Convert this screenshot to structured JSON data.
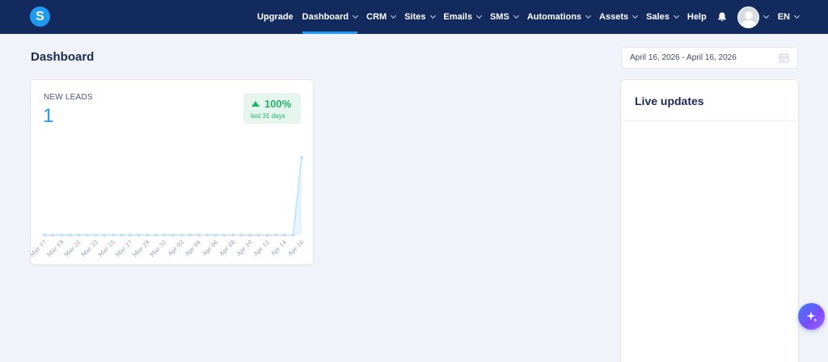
{
  "brand": {
    "logo_letter": "S"
  },
  "nav": {
    "items": [
      {
        "label": "Upgrade",
        "dropdown": false,
        "active": false
      },
      {
        "label": "Dashboard",
        "dropdown": true,
        "active": true
      },
      {
        "label": "CRM",
        "dropdown": true,
        "active": false
      },
      {
        "label": "Sites",
        "dropdown": true,
        "active": false
      },
      {
        "label": "Emails",
        "dropdown": true,
        "active": false
      },
      {
        "label": "SMS",
        "dropdown": true,
        "active": false
      },
      {
        "label": "Automations",
        "dropdown": true,
        "active": false
      },
      {
        "label": "Assets",
        "dropdown": true,
        "active": false
      },
      {
        "label": "Sales",
        "dropdown": true,
        "active": false
      },
      {
        "label": "Help",
        "dropdown": false,
        "active": false
      }
    ],
    "language": "EN"
  },
  "page": {
    "title": "Dashboard"
  },
  "date_range": {
    "value": "April 16, 2026 - April 16, 2026"
  },
  "leads": {
    "label": "NEW LEADS",
    "value": "1",
    "change": "100%",
    "change_period": "last 31 days"
  },
  "chart_data": {
    "type": "line",
    "x": [
      "Mar 17",
      "Mar 18",
      "Mar 19",
      "Mar 20",
      "Mar 21",
      "Mar 22",
      "Mar 23",
      "Mar 24",
      "Mar 25",
      "Mar 26",
      "Mar 27",
      "Mar 28",
      "Mar 29",
      "Mar 30",
      "Mar 31",
      "Apr 01",
      "Apr 02",
      "Apr 03",
      "Apr 04",
      "Apr 05",
      "Apr 06",
      "Apr 07",
      "Apr 08",
      "Apr 09",
      "Apr 10",
      "Apr 11",
      "Apr 12",
      "Apr 13",
      "Apr 14",
      "Apr 15",
      "Apr 16"
    ],
    "tick_labels": [
      "Mar 17",
      "Mar 19",
      "Mar 21",
      "Mar 23",
      "Mar 25",
      "Mar 27",
      "Mar 29",
      "Mar 31",
      "Apr 02",
      "Apr 04",
      "Apr 06",
      "Apr 08",
      "Apr 10",
      "Apr 12",
      "Apr 14",
      "Apr 16"
    ],
    "values": [
      0,
      0,
      0,
      0,
      0,
      0,
      0,
      0,
      0,
      0,
      0,
      0,
      0,
      0,
      0,
      0,
      0,
      0,
      0,
      0,
      0,
      0,
      0,
      0,
      0,
      0,
      0,
      0,
      0,
      0,
      1
    ],
    "ylim": [
      0,
      1
    ],
    "grid": false,
    "line_color": "#bfe3fb",
    "fill_color": "#e6f4fe"
  },
  "live_updates": {
    "title": "Live updates"
  },
  "colors": {
    "nav_bg": "#132a5e",
    "accent": "#1e9bf0",
    "success": "#20b26b"
  }
}
